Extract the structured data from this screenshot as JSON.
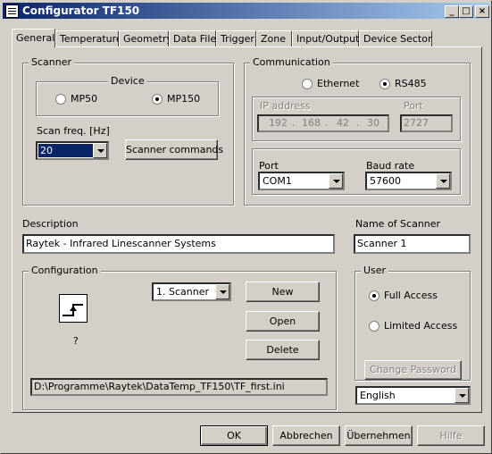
{
  "window": {
    "title": "Configurator TF150"
  },
  "tabs": [
    "General",
    "Temperature",
    "Geometry",
    "Data File",
    "Trigger",
    "Zone",
    "Input/Output",
    "Device Sector"
  ],
  "scanner": {
    "group_label": "Scanner",
    "device_label": "Device",
    "device_options": [
      "MP50",
      "MP150"
    ],
    "device_selected": "MP150",
    "scan_freq_label": "Scan freq. [Hz]",
    "scan_freq_value": "20",
    "commands_button": "Scanner commands"
  },
  "communication": {
    "group_label": "Communication",
    "mode_options": [
      "Ethernet",
      "RS485"
    ],
    "mode_selected": "RS485",
    "ip_label": "IP address",
    "ip_octets": [
      "192",
      "168",
      "42",
      "30"
    ],
    "ip_sep": ".",
    "port_net_label": "Port",
    "port_net_value": "2727",
    "port_label": "Port",
    "port_value": "COM1",
    "baud_label": "Baud rate",
    "baud_value": "57600"
  },
  "description": {
    "label": "Description",
    "value": "Raytek - Infrared Linescanner Systems"
  },
  "scanner_name": {
    "label": "Name of Scanner",
    "value": "Scanner 1"
  },
  "configuration": {
    "group_label": "Configuration",
    "icon_caption": "?",
    "select_value": "1. Scanner",
    "new_button": "New",
    "open_button": "Open",
    "delete_button": "Delete",
    "path": "D:\\Programme\\Raytek\\DataTemp_TF150\\TF_first.ini"
  },
  "user": {
    "group_label": "User",
    "options": [
      "Full Access",
      "Limited Access"
    ],
    "selected": "Full Access",
    "change_password_button": "Change Password",
    "language_value": "English"
  },
  "footer": {
    "ok_button": "OK",
    "cancel_button": "Abbrechen",
    "apply_button": "Übernehmen",
    "help_button": "Hilfe"
  }
}
